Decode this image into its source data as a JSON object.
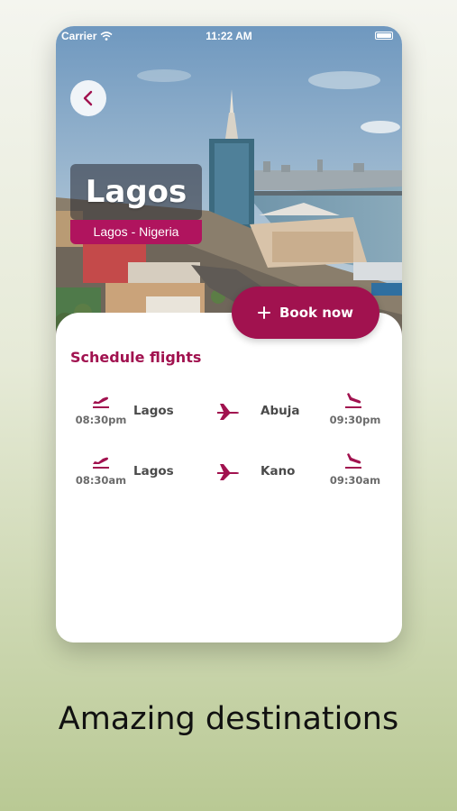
{
  "status_bar": {
    "carrier": "Carrier",
    "time": "11:22 AM"
  },
  "destination": {
    "city": "Lagos",
    "subtitle": "Lagos - Nigeria"
  },
  "book_button": {
    "label": "Book now"
  },
  "schedule": {
    "title": "Schedule flights",
    "flights": [
      {
        "from": "Lagos",
        "to": "Abuja",
        "departure": "08:30pm",
        "arrival": "09:30pm"
      },
      {
        "from": "Lagos",
        "to": "Kano",
        "departure": "08:30am",
        "arrival": "09:30am"
      }
    ]
  },
  "tagline": "Amazing destinations",
  "colors": {
    "accent": "#a1124f",
    "pill": "#b0145e"
  },
  "icons": [
    "wifi-icon",
    "battery-icon",
    "chevron-left-icon",
    "plus-icon",
    "takeoff-icon",
    "plane-icon",
    "landing-icon"
  ]
}
